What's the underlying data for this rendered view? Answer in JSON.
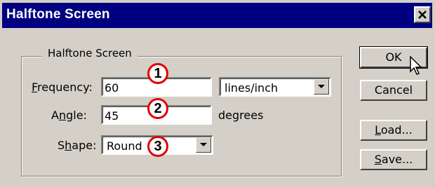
{
  "window": {
    "title": "Halftone Screen"
  },
  "group": {
    "legend": "Halftone Screen"
  },
  "fields": {
    "frequency": {
      "label_pre": "",
      "label_key": "F",
      "label_post": "requency:",
      "value": "60",
      "unit_option": "lines/inch"
    },
    "angle": {
      "label_pre": "A",
      "label_key": "n",
      "label_post": "gle:",
      "value": "45",
      "unit": "degrees"
    },
    "shape": {
      "label_pre": "S",
      "label_key": "h",
      "label_post": "ape:",
      "value": "Round"
    }
  },
  "buttons": {
    "ok": "OK",
    "cancel": "Cancel",
    "load_key": "L",
    "load_rest": "oad...",
    "save_key": "S",
    "save_rest": "ave..."
  },
  "callouts": [
    "1",
    "2",
    "3"
  ],
  "icons": {
    "close": "close-icon",
    "dropdown": "chevron-down-icon",
    "cursor": "pointer-cursor-icon"
  }
}
